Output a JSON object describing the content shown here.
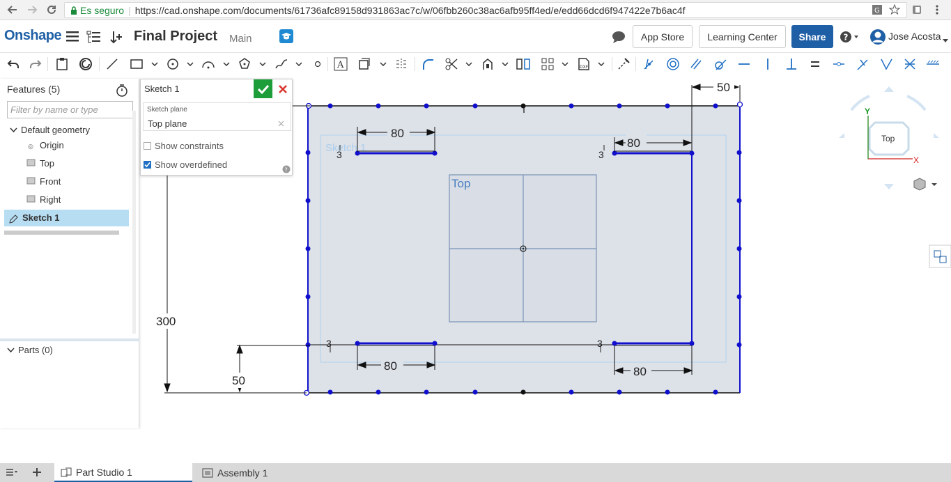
{
  "browser": {
    "secure_label": "Es seguro",
    "url": "https://cad.onshape.com/documents/61736afc89158d931863ac7c/w/06fbb260c38ac6afb95ff4ed/e/edd66dcd6f947422e7b6ac4f"
  },
  "header": {
    "logo": "Onshape",
    "doc_name": "Final Project",
    "branch": "Main",
    "app_store": "App Store",
    "learning_center": "Learning Center",
    "share": "Share",
    "user": "Jose Acosta"
  },
  "features": {
    "title": "Features (5)",
    "filter_placeholder": "Filter by name or type",
    "default_geometry": "Default geometry",
    "items": [
      "Origin",
      "Top",
      "Front",
      "Right"
    ],
    "sketch": "Sketch 1",
    "parts": "Parts (0)"
  },
  "dialog": {
    "title": "Sketch 1",
    "plane_label": "Sketch plane",
    "plane_value": "Top plane",
    "show_constraints": "Show constraints",
    "show_constraints_checked": false,
    "show_overdefined": "Show overdefined",
    "show_overdefined_checked": true
  },
  "sketch": {
    "sketch_label": "Sketch 1",
    "plane_label": "Top",
    "dim_300": "300",
    "dim_50_left": "50",
    "dim_50_top": "50",
    "dim_80": "80",
    "constraint_3": "3"
  },
  "view_cube": {
    "face": "Top",
    "x_axis": "X",
    "y_axis": "Y"
  },
  "tabs": {
    "part_studio": "Part Studio 1",
    "assembly": "Assembly 1"
  },
  "colors": {
    "brand": "#1f5fa6",
    "sketch_blue": "#0000cc",
    "ok_green": "#1e9e3a",
    "close_red": "#d9342b"
  }
}
